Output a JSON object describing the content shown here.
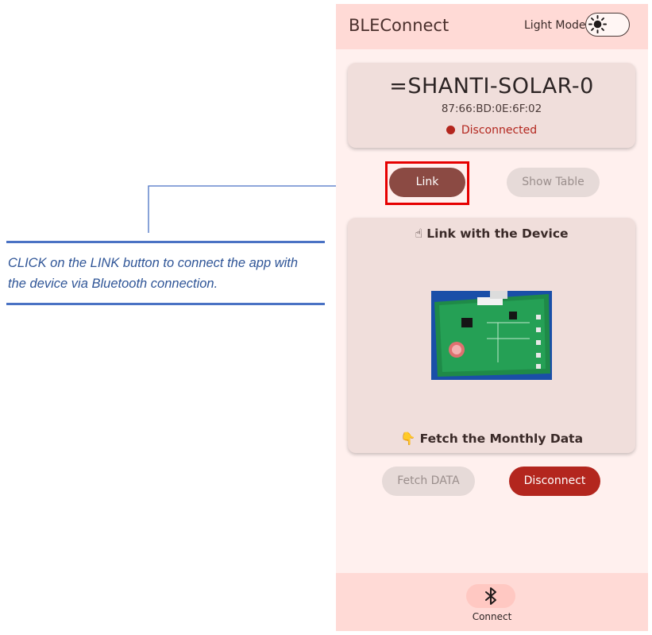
{
  "annotation": {
    "line1": "CLICK on the LINK button to connect the app with",
    "line2": "the device via Bluetooth connection."
  },
  "app": {
    "title": "BLEConnect",
    "mode_label": "Light Mode",
    "mode_icon": "sun-icon"
  },
  "device": {
    "name": "=SHANTI-SOLAR-0",
    "mac": "87:66:BD:0E:6F:02",
    "status": "Disconnected",
    "status_color": "#b3261e"
  },
  "actions": {
    "link_label": "Link",
    "show_table_label": "Show Table",
    "fetch_label": "Fetch DATA",
    "disconnect_label": "Disconnect"
  },
  "instructions": {
    "link_title": "☝ Link with the Device",
    "fetch_title": "👇 Fetch the Monthly Data",
    "image_icon": "circuit-board-image"
  },
  "nav": {
    "items": [
      {
        "label": "Connect",
        "icon": "bluetooth-icon",
        "active": true
      }
    ]
  },
  "colors": {
    "primary": "#8b4a43",
    "header": "#ffdad6",
    "background": "#fff0ee",
    "danger": "#b3261e",
    "annotation": "#2f5597",
    "highlight": "#e60000"
  }
}
